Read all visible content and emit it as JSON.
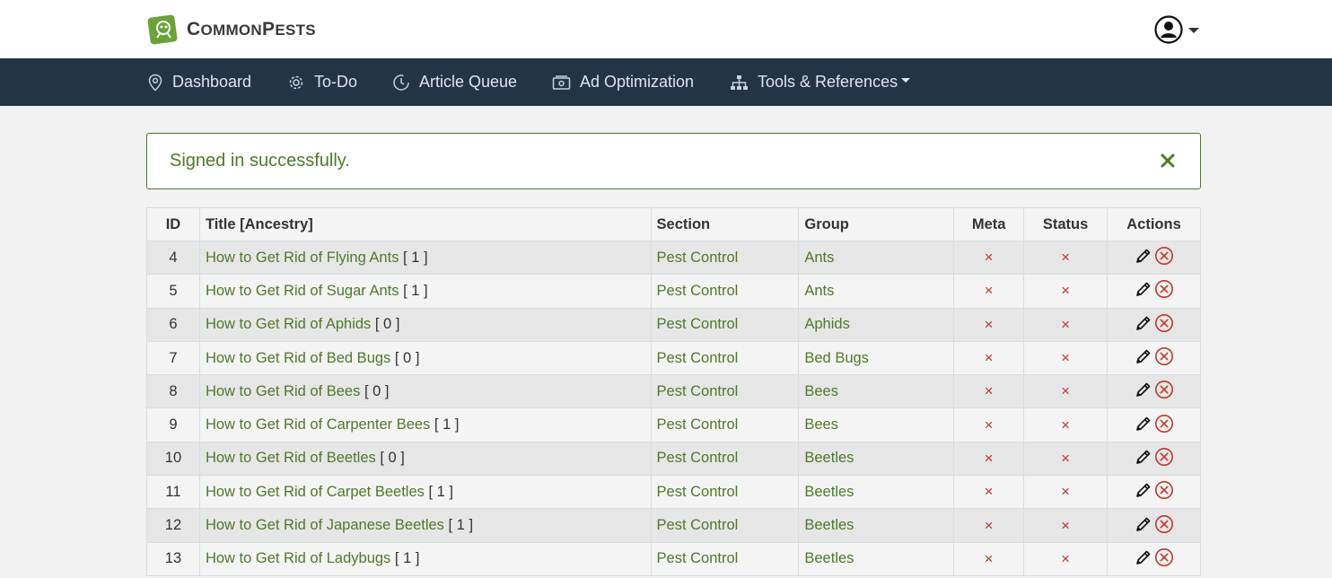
{
  "brand": {
    "first_letter": "C",
    "first_rest": "OMMON",
    "second_letter": "P",
    "second_rest": "ESTS"
  },
  "nav": {
    "dashboard": "Dashboard",
    "todo": "To-Do",
    "article_queue": "Article Queue",
    "ad_optimization": "Ad Optimization",
    "tools": "Tools & References"
  },
  "alert": {
    "message": "Signed in successfully."
  },
  "table": {
    "headers": {
      "id": "ID",
      "title": "Title [Ancestry]",
      "section": "Section",
      "group": "Group",
      "meta": "Meta",
      "status": "Status",
      "actions": "Actions"
    },
    "rows": [
      {
        "id": "4",
        "title": "How to Get Rid of Flying Ants",
        "ancestry": "[ 1 ]",
        "section": "Pest Control",
        "group": "Ants",
        "meta": "×",
        "status": "×"
      },
      {
        "id": "5",
        "title": "How to Get Rid of Sugar Ants",
        "ancestry": "[ 1 ]",
        "section": "Pest Control",
        "group": "Ants",
        "meta": "×",
        "status": "×"
      },
      {
        "id": "6",
        "title": "How to Get Rid of Aphids",
        "ancestry": "[ 0 ]",
        "section": "Pest Control",
        "group": "Aphids",
        "meta": "×",
        "status": "×"
      },
      {
        "id": "7",
        "title": "How to Get Rid of Bed Bugs",
        "ancestry": "[ 0 ]",
        "section": "Pest Control",
        "group": "Bed Bugs",
        "meta": "×",
        "status": "×"
      },
      {
        "id": "8",
        "title": "How to Get Rid of Bees",
        "ancestry": "[ 0 ]",
        "section": "Pest Control",
        "group": "Bees",
        "meta": "×",
        "status": "×"
      },
      {
        "id": "9",
        "title": "How to Get Rid of Carpenter Bees",
        "ancestry": "[ 1 ]",
        "section": "Pest Control",
        "group": "Bees",
        "meta": "×",
        "status": "×"
      },
      {
        "id": "10",
        "title": "How to Get Rid of Beetles",
        "ancestry": "[ 0 ]",
        "section": "Pest Control",
        "group": "Beetles",
        "meta": "×",
        "status": "×"
      },
      {
        "id": "11",
        "title": "How to Get Rid of Carpet Beetles",
        "ancestry": "[ 1 ]",
        "section": "Pest Control",
        "group": "Beetles",
        "meta": "×",
        "status": "×"
      },
      {
        "id": "12",
        "title": "How to Get Rid of Japanese Beetles",
        "ancestry": "[ 1 ]",
        "section": "Pest Control",
        "group": "Beetles",
        "meta": "×",
        "status": "×"
      },
      {
        "id": "13",
        "title": "How to Get Rid of Ladybugs",
        "ancestry": "[ 1 ]",
        "section": "Pest Control",
        "group": "Beetles",
        "meta": "×",
        "status": "×"
      }
    ]
  },
  "colors": {
    "accent_green": "#4e7a2a",
    "navbar": "#243447",
    "danger": "#c0392b"
  },
  "icons": {
    "logo": "common-pests-logo-icon",
    "user": "user-circle-icon",
    "dashboard": "map-pin-icon",
    "todo": "gear-icon",
    "article_queue": "clock-icon",
    "ad_optimization": "money-icon",
    "tools": "sitemap-icon",
    "close": "close-icon",
    "edit": "pencil-icon",
    "delete": "circle-x-icon"
  }
}
